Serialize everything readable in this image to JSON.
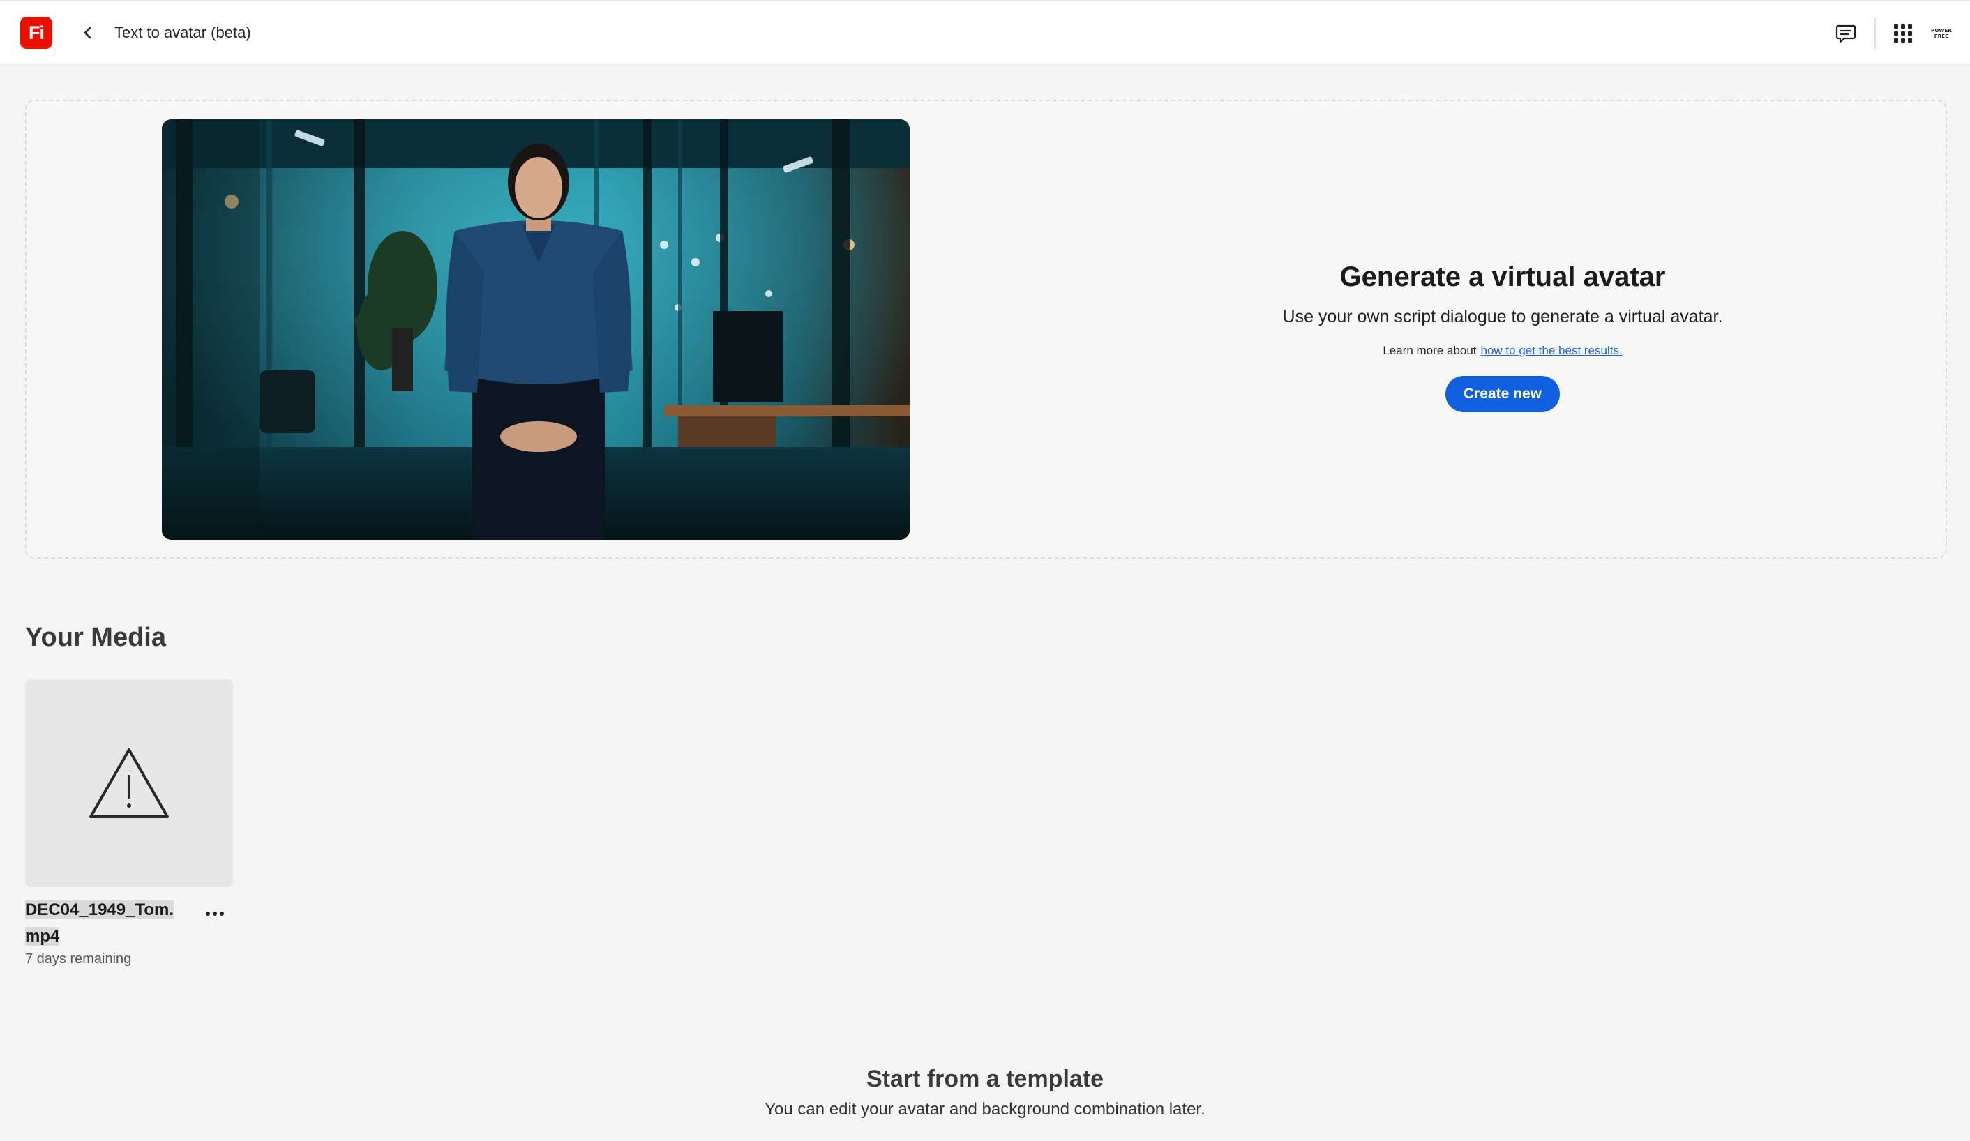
{
  "header": {
    "app_logo_text": "Fi",
    "page_title": "Text to avatar (beta)",
    "user_badge_lines": [
      "POWER",
      "FREE"
    ],
    "icons": {
      "back": "chevron-left-icon",
      "feedback": "chat-icon",
      "apps": "app-grid-icon"
    }
  },
  "hero": {
    "title": "Generate a virtual avatar",
    "subtitle": "Use your own script dialogue to generate a virtual avatar.",
    "learn_prefix": "Learn more about",
    "learn_link": "how to get the best results.",
    "create_button": "Create new"
  },
  "media": {
    "heading": "Your Media",
    "items": [
      {
        "name_line1": "DEC04_1949_Tom.",
        "name_line2": "mp4",
        "meta": "7 days remaining",
        "thumb_icon": "warning-icon"
      }
    ]
  },
  "templates": {
    "heading": "Start from a template",
    "subtitle": "You can edit your avatar and background combination later."
  },
  "colors": {
    "brand": "#eb1000",
    "accent": "#1060e0",
    "link": "#1a64d6"
  }
}
